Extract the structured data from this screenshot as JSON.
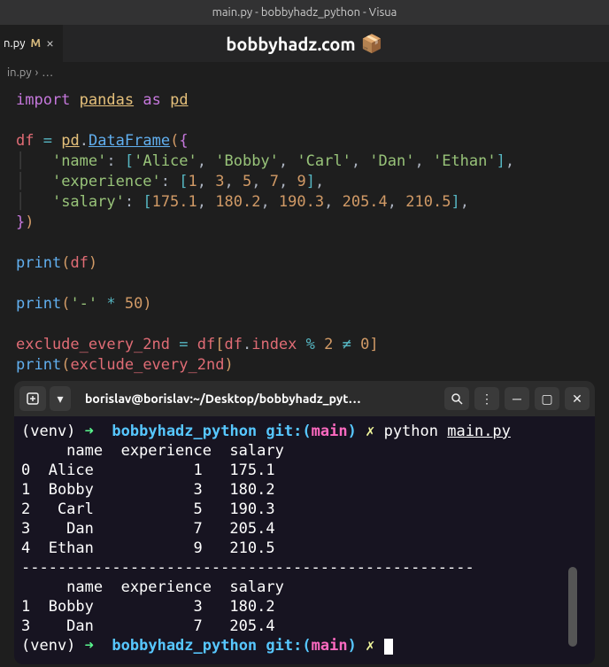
{
  "window": {
    "title": "main.py - bobbyhadz_python - Visua"
  },
  "tab": {
    "filename": "n.py",
    "modified_marker": "M",
    "close_glyph": "×"
  },
  "watermark": {
    "text": "bobbyhadz.com",
    "emoji": "📦"
  },
  "breadcrumb": {
    "file": "in.py",
    "chevron": "›",
    "more": "…"
  },
  "code": {
    "l1": {
      "import": "import",
      "module": "pandas",
      "as": "as",
      "alias": "pd"
    },
    "l3": {
      "var": "df",
      "eq": "=",
      "obj": "pd",
      "cls": "DataFrame"
    },
    "l4": {
      "key": "'name'",
      "vals": [
        "'Alice'",
        "'Bobby'",
        "'Carl'",
        "'Dan'",
        "'Ethan'"
      ]
    },
    "l5": {
      "key": "'experience'",
      "vals": [
        "1",
        "3",
        "5",
        "7",
        "9"
      ]
    },
    "l6": {
      "key": "'salary'",
      "vals": [
        "175.1",
        "180.2",
        "190.3",
        "205.4",
        "210.5"
      ]
    },
    "l9": {
      "fn": "print",
      "arg": "df"
    },
    "l11": {
      "fn": "print",
      "str": "'-'",
      "op": "*",
      "num": "50"
    },
    "l13": {
      "var": "exclude_every_2nd",
      "eq": "=",
      "df": "df",
      "index": "index",
      "mod": "%",
      "two": "2",
      "neq": "!=",
      "zero": "0"
    },
    "l14": {
      "fn": "print",
      "arg": "exclude_every_2nd"
    }
  },
  "chart_data": {
    "type": "table",
    "title": "DataFrame output",
    "columns": [
      "",
      "name",
      "experience",
      "salary"
    ],
    "rows_full": [
      [
        0,
        "Alice",
        1,
        175.1
      ],
      [
        1,
        "Bobby",
        3,
        180.2
      ],
      [
        2,
        "Carl",
        5,
        190.3
      ],
      [
        3,
        "Dan",
        7,
        205.4
      ],
      [
        4,
        "Ethan",
        9,
        210.5
      ]
    ],
    "rows_filtered": [
      [
        1,
        "Bobby",
        3,
        180.2
      ],
      [
        3,
        "Dan",
        7,
        205.4
      ]
    ]
  },
  "terminal": {
    "title": "borislav@borislav:~/Desktop/bobbyhadz_pyt…",
    "prompt": {
      "venv": "(venv)",
      "arrow": "➜",
      "dir": "bobbyhadz_python",
      "git_label": "git:",
      "branch": "main",
      "x": "✗"
    },
    "cmd1": {
      "exe": "python",
      "file": "main.py"
    },
    "out_header": "     name  experience  salary",
    "out_rows": [
      "0  Alice           1   175.1",
      "1  Bobby           3   180.2",
      "2   Carl           5   190.3",
      "3    Dan           7   205.4",
      "4  Ethan           9   210.5"
    ],
    "divider": "--------------------------------------------------",
    "out_header2": "     name  experience  salary",
    "out_rows2": [
      "1  Bobby           3   180.2",
      "3    Dan           7   205.4"
    ]
  }
}
